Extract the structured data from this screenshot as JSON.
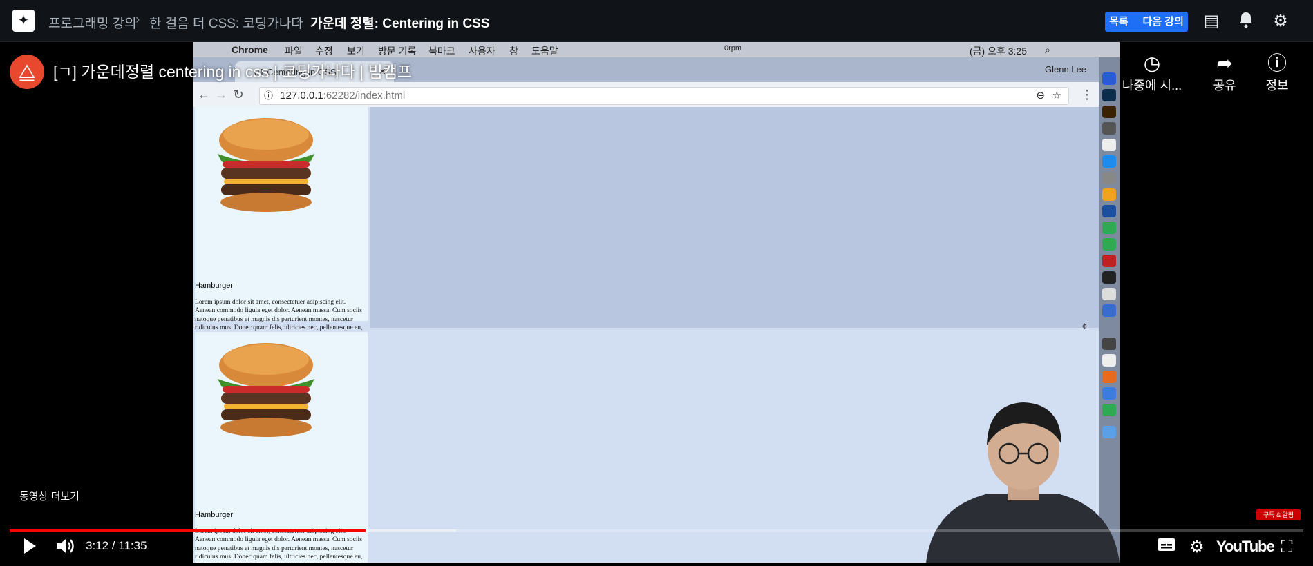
{
  "breadcrumb": {
    "items": [
      "프로그래밍 강의",
      "한 걸음 더 CSS: 코딩가나다",
      "가운데 정렬: Centering in CSS"
    ]
  },
  "topbar_buttons": {
    "list": "목록",
    "next": "다음 강의"
  },
  "colors": {
    "accent": "#1e6ff5",
    "progress": "#ff0000",
    "channel": "#e8492e"
  },
  "video": {
    "title": "[ㄱ] 가운데정렬 centering in css | 코딩가나다 | 빔캠프",
    "actions": [
      {
        "icon": "clock-icon",
        "label": "나중에 시..."
      },
      {
        "icon": "share-icon",
        "label": "공유"
      },
      {
        "icon": "info-icon",
        "label": "정보"
      }
    ],
    "more_videos": "동영상 더보기",
    "time": "3:12 / 11:35",
    "progress": 0.275,
    "buffer": 0.345,
    "logo": "YouTube",
    "subscribe_badge": "구독 & 알림"
  },
  "mac": {
    "menu": [
      "Chrome",
      "파일",
      "수정",
      "보기",
      "방문 기록",
      "북마크",
      "사용자",
      "창",
      "도움말"
    ],
    "status": [
      "0rpm",
      "(금) 오후 3:25"
    ]
  },
  "browser": {
    "tab_title": "01 Centering in CSS",
    "user": "Glenn Lee",
    "url_host": "127.0.0.1",
    "url_rest": ":62282/index.html"
  },
  "cards": [
    {
      "title": "Hamburger",
      "text": "Lorem ipsum dolor sit amet, consectetuer adipiscing elit. Aenean commodo ligula eget dolor. Aenean massa. Cum sociis natoque penatibus et magnis dis parturient montes, nascetur ridiculus mus. Donec quam felis, ultricies nec, pellentesque eu, pretium quis, sem. Nulla consequat massa quis enim. Donec pede justo, fringilla vel, aliquet nec, vulputate eget, arcu. In enim justo, rhoncus ut, imperdiet a, venenatis vitae"
    },
    {
      "title": "Hamburger",
      "text": "Lorem ipsum dolor sit amet, consectetuer adipiscing elit. Aenean commodo ligula eget dolor. Aenean massa. Cum sociis natoque penatibus et magnis dis parturient montes, nascetur ridiculus mus. Donec quam felis, ultricies nec, pellentesque eu, pretium quis, sem. Nulla consequat massa quis enim. Donec pede justo, fringilla vel, aliquet nec, vulputate eget, arcu. In enim justo, rhoncus ut, imperdiet a, venenatis vitae"
    }
  ]
}
